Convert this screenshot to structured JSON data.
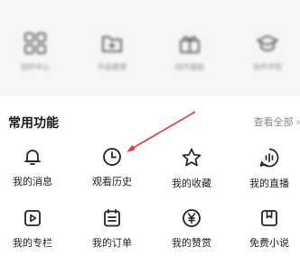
{
  "top_shortcuts": [
    {
      "label": "创作中心",
      "icon": "grid-icon"
    },
    {
      "label": "作品管理",
      "icon": "folder-plus-icon"
    },
    {
      "label": "创作激励",
      "icon": "gift-icon"
    },
    {
      "label": "创作学院",
      "icon": "graduation-cap-icon"
    }
  ],
  "common_functions": {
    "title": "常用功能",
    "view_all": "查看全部",
    "items": [
      {
        "label": "我的消息",
        "icon": "bell-icon"
      },
      {
        "label": "观看历史",
        "icon": "clock-icon"
      },
      {
        "label": "我的收藏",
        "icon": "star-icon"
      },
      {
        "label": "我的直播",
        "icon": "live-icon"
      },
      {
        "label": "我的专栏",
        "icon": "column-play-icon"
      },
      {
        "label": "我的订单",
        "icon": "order-icon"
      },
      {
        "label": "我的赞赏",
        "icon": "yuan-coin-icon"
      },
      {
        "label": "免费小说",
        "icon": "bookmark-book-icon"
      }
    ]
  },
  "colors": {
    "annotation_arrow": "#e53935",
    "panel_bg": "#f6f6f6"
  }
}
